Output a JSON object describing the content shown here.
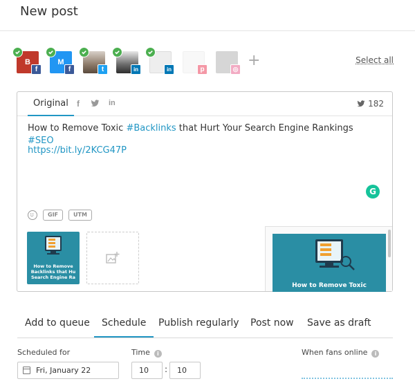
{
  "header": {
    "title": "New post"
  },
  "accounts": {
    "items": [
      {
        "name": "account-1-facebook",
        "initial": "B",
        "bg": "#c0392b",
        "network": "facebook",
        "badge_color": "#3b5998",
        "badge_glyph": "f",
        "checked": true
      },
      {
        "name": "account-2-facebook",
        "initial": "M",
        "bg": "#2196f3",
        "network": "facebook",
        "badge_color": "#3b5998",
        "badge_glyph": "f",
        "checked": true
      },
      {
        "name": "account-3-twitter",
        "initial": "",
        "bg": "#8d7b6a",
        "network": "twitter",
        "badge_color": "#1da1f2",
        "badge_glyph": "t",
        "checked": true
      },
      {
        "name": "account-4-linkedin",
        "initial": "",
        "bg": "#6b6b6b",
        "network": "linkedin",
        "badge_color": "#0077b5",
        "badge_glyph": "in",
        "checked": true
      },
      {
        "name": "account-5-linkedin",
        "initial": "",
        "bg": "#e5e5e5",
        "network": "linkedin",
        "badge_color": "#0077b5",
        "badge_glyph": "in",
        "checked": true
      },
      {
        "name": "account-6-pinterest",
        "initial": "",
        "bg": "#e5e5e5",
        "network": "pinterest",
        "badge_color": "#e60023",
        "badge_glyph": "p",
        "checked": false
      },
      {
        "name": "account-7-instagram",
        "initial": "",
        "bg": "#9a9a9a",
        "network": "instagram",
        "badge_color": "#e1306c",
        "badge_glyph": "◎",
        "checked": false
      }
    ],
    "add_label": "+",
    "select_all_label": "Select all"
  },
  "editor": {
    "tab_original": "Original",
    "char_count": "182",
    "text_before": "How to Remove Toxic ",
    "hashtag_1": "#Backlinks",
    "text_middle": " that Hurt Your Search Engine Rankings ",
    "hashtag_2": "#SEO",
    "link": "https://bit.ly/2KCG47P",
    "grammarly_label": "G",
    "gif_label": "GIF",
    "utm_label": "UTM",
    "thumb_title": "How to Remove Backlinks that Hu Search Engine Ra",
    "preview_title": "How to Remove Toxic"
  },
  "modes": {
    "add_to_queue": "Add to queue",
    "schedule": "Schedule",
    "publish_regularly": "Publish regularly",
    "post_now": "Post now",
    "save_as_draft": "Save as draft"
  },
  "schedule": {
    "scheduled_for_label": "Scheduled for",
    "date_value": "Fri, January 22",
    "time_label": "Time",
    "hour_value": "10",
    "minute_value": "10",
    "time_separator": ":",
    "fans_online_label": "When fans online"
  },
  "colors": {
    "accent": "#2196c4",
    "check": "#4caf50"
  }
}
